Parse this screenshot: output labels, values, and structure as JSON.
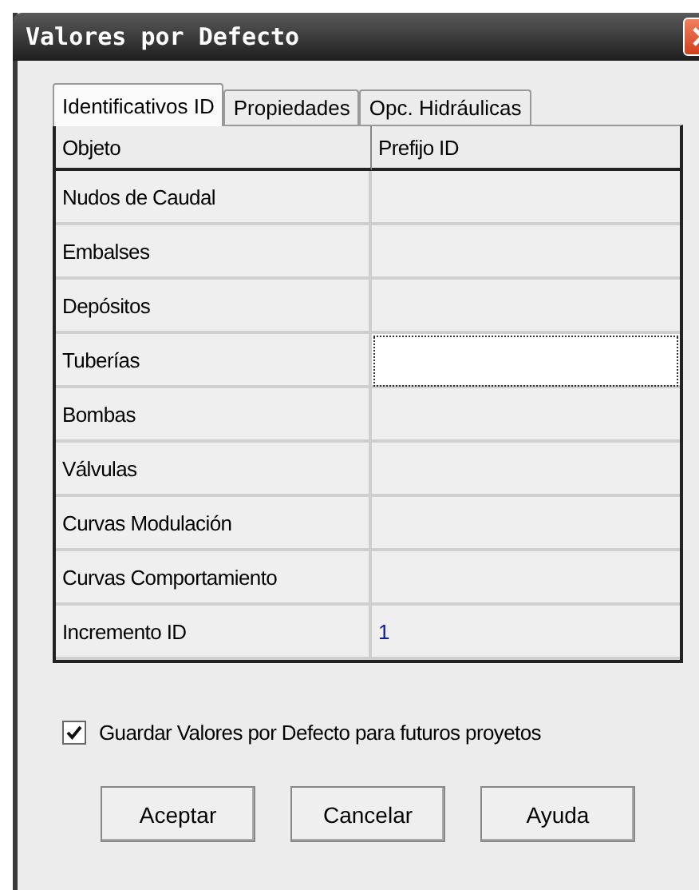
{
  "window": {
    "title": "Valores por Defecto"
  },
  "tabs": [
    {
      "label": "Identificativos ID",
      "selected": true
    },
    {
      "label": "Propiedades",
      "selected": false
    },
    {
      "label": "Opc. Hidráulicas",
      "selected": false
    }
  ],
  "table": {
    "columns": [
      "Objeto",
      "Prefijo ID"
    ],
    "rows": [
      {
        "object": "Nudos de Caudal",
        "selected": false
      },
      {
        "object": "Embalses",
        "selected": false
      },
      {
        "object": "Depósitos",
        "selected": false
      },
      {
        "object": "Tuberías",
        "selected": true
      },
      {
        "object": "Bombas",
        "selected": false
      },
      {
        "object": "Válvulas",
        "selected": false
      },
      {
        "object": "Curvas Modulación",
        "selected": false
      },
      {
        "object": "Curvas Comportamiento",
        "selected": false
      },
      {
        "object": "Incremento ID",
        "value": "1",
        "selected": false
      }
    ]
  },
  "save_defaults": {
    "label": "Guardar Valores por Defecto para futuros proyetos",
    "checked": true
  },
  "buttons": [
    "Aceptar",
    "Cancelar",
    "Ayuda"
  ]
}
